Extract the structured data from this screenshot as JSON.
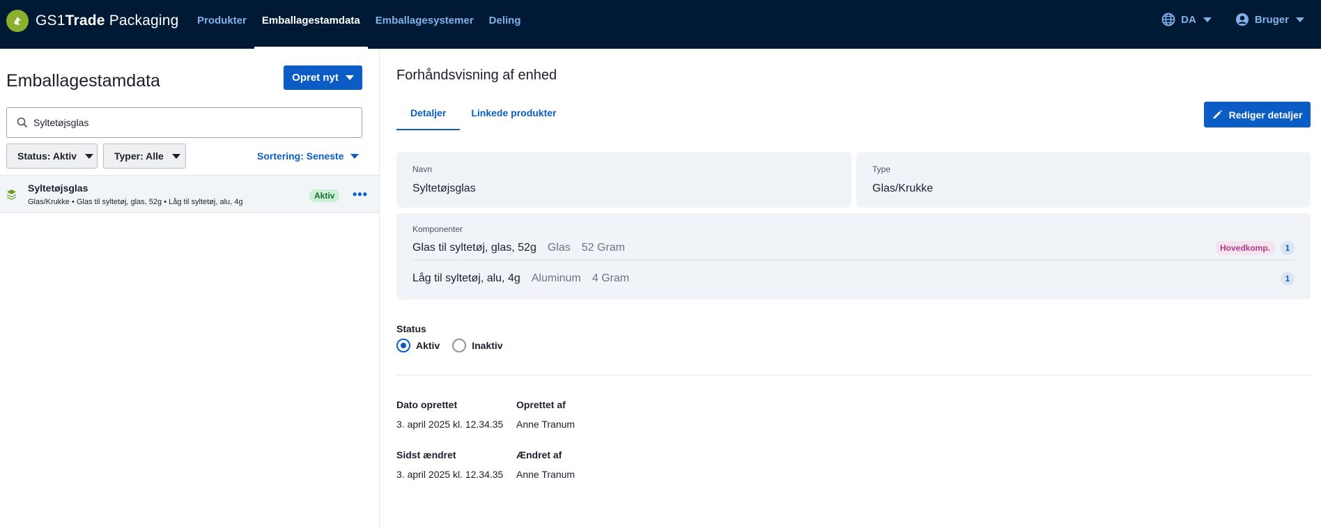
{
  "header": {
    "brand_prefix": "GS1",
    "brand_bold": "Trade",
    "brand_suffix": " Packaging",
    "nav": [
      {
        "label": "Produkter",
        "active": false
      },
      {
        "label": "Emballagestamdata",
        "active": true
      },
      {
        "label": "Emballagesystemer",
        "active": false
      },
      {
        "label": "Deling",
        "active": false
      }
    ],
    "language": "DA",
    "user": "Bruger"
  },
  "left": {
    "title": "Emballagestamdata",
    "create_button": "Opret nyt",
    "search_value": "Syltetøjsglas",
    "filter_status": "Status: Aktiv",
    "filter_types": "Typer: Alle",
    "sort": "Sortering: Seneste",
    "items": [
      {
        "name": "Syltetøjsglas",
        "subtitle": "Glas/Krukke • Glas til syltetøj, glas, 52g • Låg til syltetøj, alu, 4g",
        "badge": "Aktiv"
      }
    ]
  },
  "detail": {
    "title": "Forhåndsvisning af enhed",
    "tabs": [
      "Detaljer",
      "Linkede produkter"
    ],
    "edit_button": "Rediger detaljer",
    "name_label": "Navn",
    "name_value": "Syltetøjsglas",
    "type_label": "Type",
    "type_value": "Glas/Krukke",
    "components_label": "Komponenter",
    "components": [
      {
        "name": "Glas til syltetøj, glas, 52g",
        "material": "Glas",
        "weight": "52 Gram",
        "tag": "Hovedkomp.",
        "count": "1"
      },
      {
        "name": "Låg til syltetøj, alu, 4g",
        "material": "Aluminum",
        "weight": "4 Gram",
        "tag": "",
        "count": "1"
      }
    ],
    "status_label": "Status",
    "status_options": [
      "Aktiv",
      "Inaktiv"
    ],
    "status_selected": "Aktiv",
    "created_date_label": "Dato oprettet",
    "created_date_value": "3. april 2025 kl. 12.34.35",
    "created_by_label": "Oprettet af",
    "created_by_value": "Anne Tranum",
    "modified_date_label": "Sidst ændret",
    "modified_date_value": "3. april 2025 kl. 12.34.35",
    "modified_by_label": "Ændret af",
    "modified_by_value": "Anne Tranum"
  },
  "colors": {
    "topbar": "#001a36",
    "accent": "#0b5cc4",
    "brand_green": "#8bb02e",
    "card_bg": "#f0f4f8"
  }
}
